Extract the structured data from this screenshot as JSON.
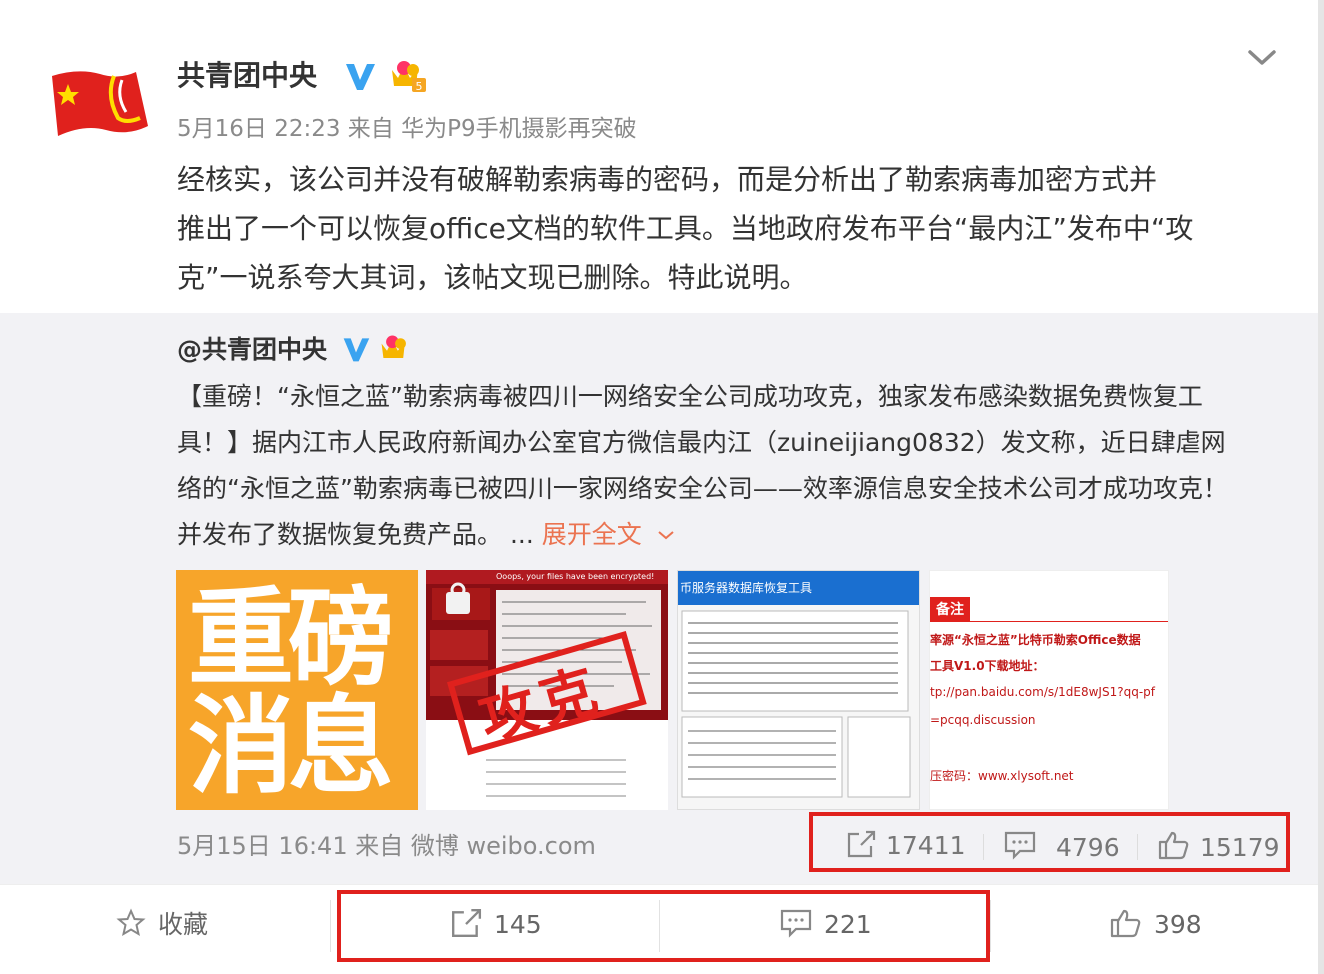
{
  "post": {
    "author": "共青团中央",
    "meta": "5月16日 22:23 来自 华为P9手机摄影再突破",
    "text_lines": [
      "经核实，该公司并没有破解勒索病毒的密码，而是分析出了勒索病毒加密方式并",
      "推出了一个可以恢复office文档的软件工具。当地政府发布平台“最内江”发布中“攻",
      "克”一说系夸大其词，该帖文现已删除。特此说明。"
    ]
  },
  "repost": {
    "author": "@共青团中央",
    "text_lines": [
      "【重磅！“永恒之蓝”勒索病毒被四川一网络安全公司成功攻克，独家发布感染数据免费恢复工",
      "具！】据内江市人民政府新闻办公室官方微信最内江（zuineijiang0832）发文称，近日肆虐网",
      "络的“永恒之蓝”勒索病毒已被四川一家网络安全公司——效率源信息安全技术公司才成功攻克！",
      "并发布了数据恢复免费产品。 ..."
    ],
    "expand_label": "展开全文",
    "images": {
      "img1_line1": "重磅",
      "img1_line2": "消息",
      "img2_stamp": "攻克",
      "img2_header": "Ooops, your files have been encrypted!",
      "img3_header": "币服务器数据库恢复工具",
      "img4_tag": "备注",
      "img4_lines": [
        "率源“永恒之蓝”比特币勒索Office数据",
        "工具V1.0下载地址：",
        "tp://pan.baidu.com/s/1dE8wJS1?qq-pf",
        "=pcqq.discussion",
        "压密码：www.xlysoft.net"
      ]
    },
    "meta": "5月15日 16:41 来自 微博 weibo.com",
    "forward_count": "17411",
    "comment_count": "4796",
    "like_count": "15179"
  },
  "actions": {
    "favorite_label": "收藏",
    "forward_count": "145",
    "comment_count": "221",
    "like_count": "398"
  },
  "colors": {
    "highlight_box": "#e0211d",
    "link_orange": "#eb7350",
    "verified_blue": "#3aa3f0"
  }
}
